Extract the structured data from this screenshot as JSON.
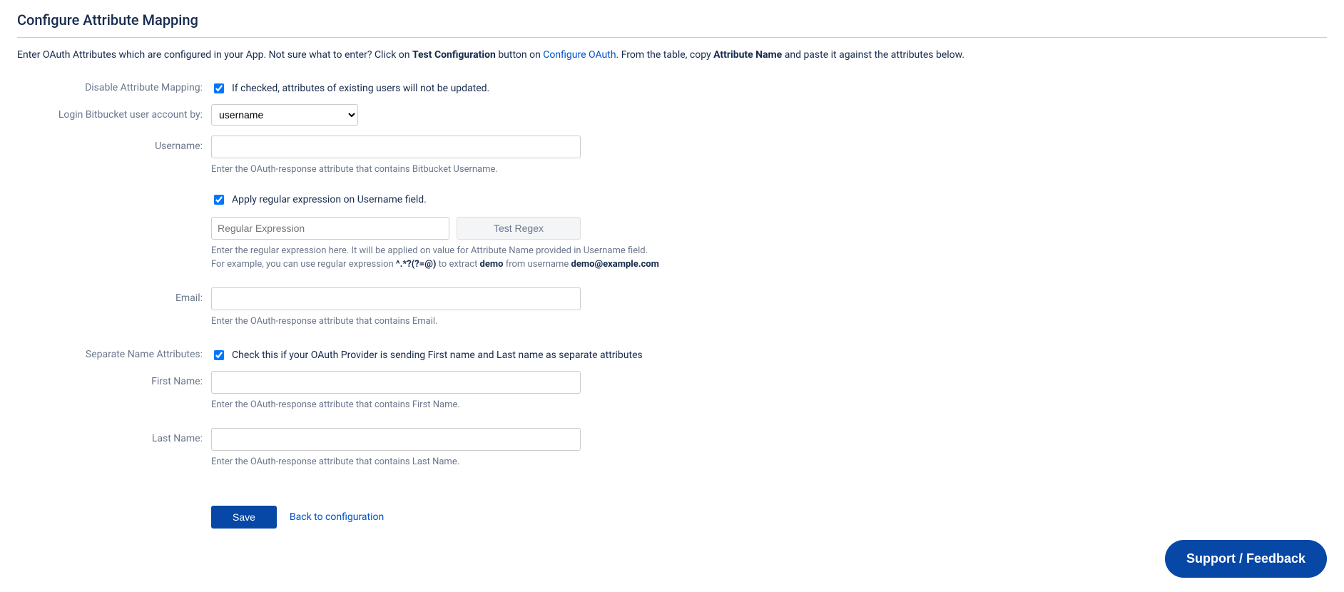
{
  "header": {
    "title": "Configure Attribute Mapping"
  },
  "intro": {
    "part1": "Enter OAuth Attributes which are configured in your App. Not sure what to enter? Click on ",
    "bold1": "Test Configuration",
    "part2": " button on ",
    "link": "Configure OAuth",
    "part3": ". From the table, copy ",
    "bold2": "Attribute Name",
    "part4": " and paste it against the attributes below."
  },
  "form": {
    "disable_mapping": {
      "label": "Disable Attribute Mapping:",
      "text": "If checked, attributes of existing users will not be updated."
    },
    "login_by": {
      "label": "Login Bitbucket user account by:",
      "selected": "username"
    },
    "username": {
      "label": "Username:",
      "help": "Enter the OAuth-response attribute that contains Bitbucket Username."
    },
    "apply_regex": {
      "text": "Apply regular expression on Username field."
    },
    "regex": {
      "placeholder": "Regular Expression",
      "button": "Test Regex",
      "help1": "Enter the regular expression here. It will be applied on value for Attribute Name provided in Username field.",
      "help2a": "For example, you can use regular expression ",
      "help2b": "^.*?(?=@)",
      "help2c": " to extract ",
      "help2d": "demo",
      "help2e": " from username ",
      "help2f": "demo@example.com"
    },
    "email": {
      "label": "Email:",
      "help": "Enter the OAuth-response attribute that contains Email."
    },
    "separate_name": {
      "label": "Separate Name Attributes:",
      "text": "Check this if your OAuth Provider is sending First name and Last name as separate attributes"
    },
    "first_name": {
      "label": "First Name:",
      "help": "Enter the OAuth-response attribute that contains First Name."
    },
    "last_name": {
      "label": "Last Name:",
      "help": "Enter the OAuth-response attribute that contains Last Name."
    }
  },
  "actions": {
    "save": "Save",
    "back": "Back to configuration"
  },
  "support_button": "Support / Feedback"
}
